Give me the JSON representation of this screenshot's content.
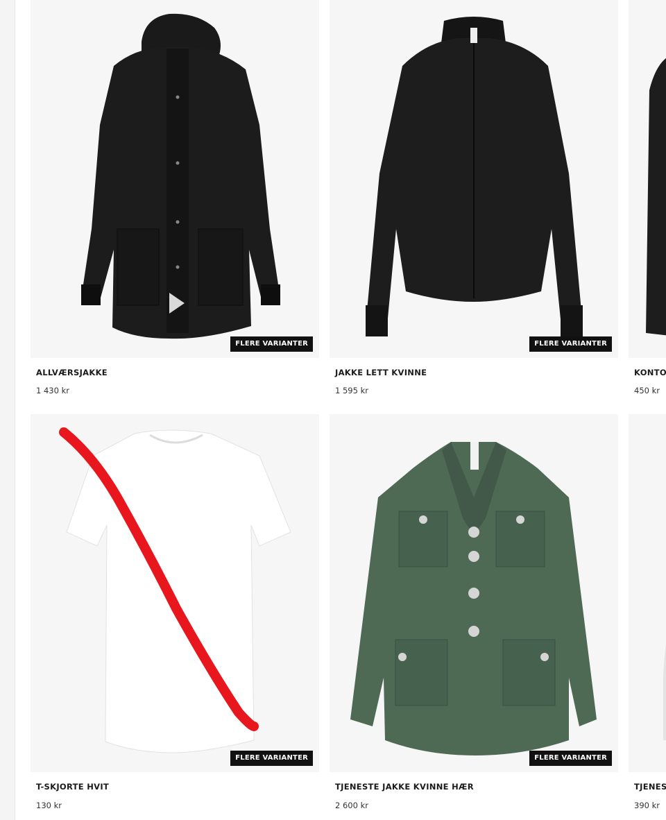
{
  "badge_label": "FLERE VARIANTER",
  "products": [
    {
      "title": "ALLVÆRSJAKKE",
      "price": "1 430 kr",
      "image": "black-parka-jacket"
    },
    {
      "title": "JAKKE LETT KVINNE",
      "price": "1 595 kr",
      "image": "black-zip-jacket"
    },
    {
      "title": "KONTO",
      "price": "450 kr",
      "image": "black-garment-partial"
    },
    {
      "title": "T-SKJORTE HVIT",
      "price": "130 kr",
      "image": "white-tshirt"
    },
    {
      "title": "TJENESTE JAKKE KVINNE HÆR",
      "price": "2 600 kr",
      "image": "green-uniform-jacket"
    },
    {
      "title": "TJENES",
      "price": "390 kr",
      "image": "garment-partial"
    }
  ],
  "colors": {
    "card_background": "#f6f6f6",
    "badge_background": "#111111",
    "annotation_stroke": "#e8161d",
    "uniform_green": "#4e6a55"
  }
}
